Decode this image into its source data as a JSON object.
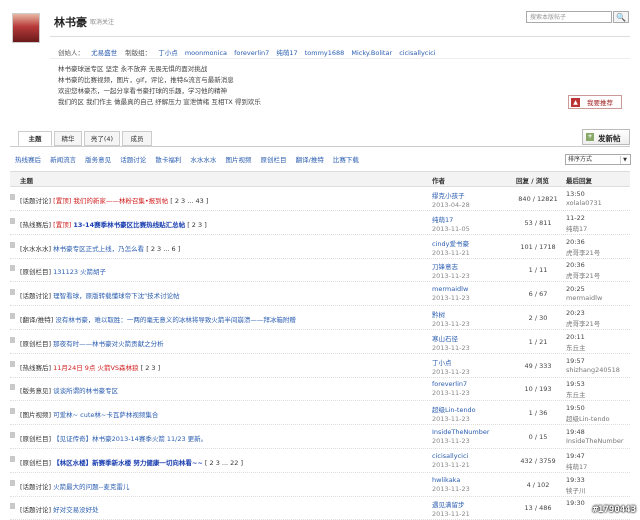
{
  "header": {
    "title": "林书豪",
    "unfollow": "取消关注",
    "search_placeholder": "搜索本版帖子",
    "search_icon": "search-icon",
    "moderators_label": "创始人：",
    "founder": "尤易盛世",
    "mod_label": "制版组：",
    "moderators": [
      "丁小点",
      "moonmonica",
      "foreverlin7",
      "纯萌17",
      "tommy1688",
      "Micky.Bolitar",
      "cicisallycici"
    ],
    "rules": [
      "林书豪球迷专区 坚定 永不放弃 无畏无惧的面对挑战",
      "林书豪的比赛视频，图片，gif，评论，推特&流言与最新消息",
      "欢迎您林豪杰，一起分享看书豪打球的乐趣，学习他的精神",
      "我们的区 我们作主 做最真的自己 纾解压力 宣泄情绪 互相TX 得到欢乐"
    ],
    "recommend": "我要推荐"
  },
  "tabs": [
    {
      "label": "主题",
      "active": true
    },
    {
      "label": "精华",
      "active": false
    },
    {
      "label": "亮了(4)",
      "active": false
    },
    {
      "label": "成员",
      "active": false
    }
  ],
  "new_post": "发新帖",
  "categories": [
    "热线赛后",
    "新闻流言",
    "版务意见",
    "话题讨论",
    "散卡福利",
    "水水水水",
    "图片视频",
    "原创栏目",
    "翻译/推特",
    "比赛下载"
  ],
  "sort": "排序方式",
  "table": {
    "headers": {
      "subject": "主题",
      "author": "作者",
      "counts": "回复 / 浏览",
      "last": "最后回复"
    },
    "rows": [
      {
        "cat": "[话题讨论]",
        "prefix": "[置顶]",
        "title": "我们的新家——林粉召集•报到帖",
        "title_style": "red",
        "pages": "[ 2 3 ... 43 ]",
        "author": "缪克小孩子",
        "date": "2013-04-28",
        "counts": "840 / 12821",
        "last_time": "13:50",
        "last_user": "xolala0731"
      },
      {
        "cat": "[热线赛后]",
        "prefix": "[置顶]",
        "title": "13-14赛季林书豪区比赛热线贴汇总帖",
        "title_style": "blue",
        "pages": "[ 2 3 ]",
        "author": "纯萌17",
        "date": "2013-11-05",
        "counts": "53 / 811",
        "last_time": "11-22",
        "last_user": "纯萌17"
      },
      {
        "cat": "[水水水水]",
        "prefix": "",
        "title": "林书豪专区正式上线，乃怎么看",
        "title_style": "normal",
        "pages": "[ 2 3 ... 6 ]",
        "author": "cindy爱书豪",
        "date": "2013-11-21",
        "counts": "101 / 1718",
        "last_time": "20:36",
        "last_user": "虎哥李21号"
      },
      {
        "cat": "[原创栏目]",
        "prefix": "",
        "title": "131123 火箭胡子",
        "title_style": "normal",
        "pages": "",
        "author": "刀锋意志",
        "date": "2013-11-23",
        "counts": "1 / 11",
        "last_time": "20:36",
        "last_user": "虎哥李21号"
      },
      {
        "cat": "[话题讨论]",
        "prefix": "",
        "title": "理智看球，原版转载懂球帝下沈\"技术讨论帖",
        "title_style": "normal",
        "pages": "",
        "author": "mermaidlw",
        "date": "2013-11-23",
        "counts": "6 / 67",
        "last_time": "20:25",
        "last_user": "mermaidlw"
      },
      {
        "cat": "[翻译/推特]",
        "prefix": "",
        "title": "没有林书豪，难以取胜：一两的毫无意义的冰林将导致火箭半间崩溃——拜冰箱附赠",
        "title_style": "normal",
        "pages": "",
        "author": "黔树",
        "date": "2013-11-23",
        "counts": "2 / 30",
        "last_time": "20:23",
        "last_user": "虎哥李21号"
      },
      {
        "cat": "[原创栏目]",
        "prefix": "",
        "title": "那夜有时——林书豪对火箭贡献之分析",
        "title_style": "normal",
        "pages": "",
        "author": "寒山石径",
        "date": "2013-11-23",
        "counts": "1 / 21",
        "last_time": "20:11",
        "last_user": "东丘主"
      },
      {
        "cat": "[热线赛后]",
        "prefix": "",
        "title": "11月24日 9点 火箭VS森林狼",
        "title_style": "red",
        "pages": "[ 2 3 ]",
        "author": "丁小点",
        "date": "2013-11-23",
        "counts": "49 / 333",
        "last_time": "19:57",
        "last_user": "shizhang240518"
      },
      {
        "cat": "[版务意见]",
        "prefix": "",
        "title": "谈谈所谓的林书豪专区",
        "title_style": "normal",
        "pages": "",
        "author": "foreverlin7",
        "date": "2013-11-23",
        "counts": "10 / 193",
        "last_time": "19:53",
        "last_user": "东丘主"
      },
      {
        "cat": "[图片视频]",
        "prefix": "",
        "title": "可爱林~ cute林~卡瓦萨林视频集合",
        "title_style": "normal",
        "pages": "",
        "author": "超级Lin-tendo",
        "date": "2013-11-23",
        "counts": "1 / 36",
        "last_time": "19:50",
        "last_user": "超级Lin-tendo"
      },
      {
        "cat": "[原创栏目]",
        "prefix": "",
        "title": "【见证传奇】林书豪2013-14赛季火箭 11/23 更新。",
        "title_style": "normal",
        "pages": "",
        "author": "InsideTheNumber",
        "date": "2013-11-23",
        "counts": "0 / 15",
        "last_time": "19:48",
        "last_user": "InsideTheNumber"
      },
      {
        "cat": "[原创栏目]",
        "prefix": "",
        "title": "【林区水楼】新赛季新水楼 努力健康一切向林看~~",
        "title_style": "blue",
        "pages": "[ 2 3 ... 22 ]",
        "author": "cicisallycici",
        "date": "2013-11-21",
        "counts": "432 / 3759",
        "last_time": "19:47",
        "last_user": "纯萌17"
      },
      {
        "cat": "[话题讨论]",
        "prefix": "",
        "title": "火箭最大的问题--麦克雷儿",
        "title_style": "normal",
        "pages": "",
        "author": "hwlikaka",
        "date": "2013-11-23",
        "counts": "4 / 102",
        "last_time": "19:33",
        "last_user": "犊子川"
      },
      {
        "cat": "[话题讨论]",
        "prefix": "",
        "title": "好对交易没好处",
        "title_style": "normal",
        "pages": "",
        "author": "遇见满留步",
        "date": "2013-11-21",
        "counts": "13 / 486",
        "last_time": "19:30",
        "last_user": ""
      }
    ]
  },
  "watermark": "#1790443"
}
